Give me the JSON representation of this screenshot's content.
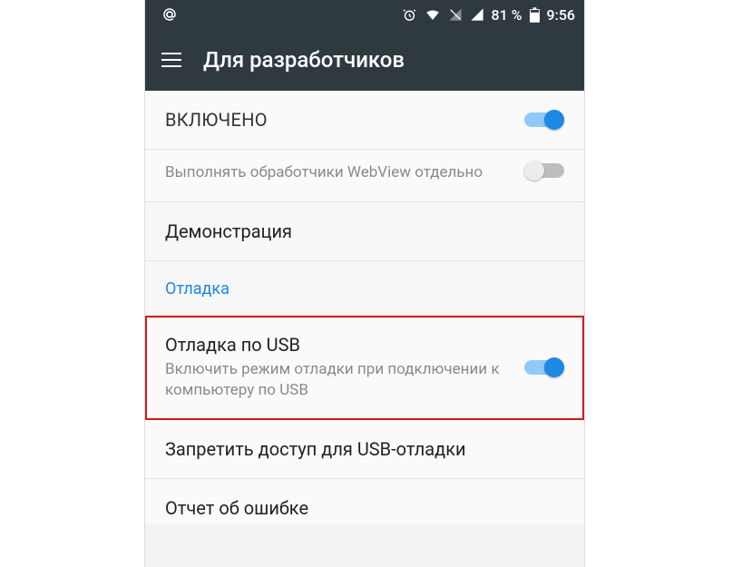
{
  "statusbar": {
    "battery_percent": "81 %",
    "time": "9:56"
  },
  "appbar": {
    "title": "Для разработчиков"
  },
  "rows": {
    "enabled_label": "ВКЛЮЧЕНО",
    "webview_secondary": "Выполнять обработчики WebView отдельно",
    "demo_label": "Демонстрация",
    "section_debug": "Отладка",
    "usb_debug_title": "Отладка по USB",
    "usb_debug_desc": "Включить режим отладки при подключении к компьютеру по USB",
    "revoke_label": "Запретить доступ для USB-отладки",
    "bugreport_label": "Отчет об ошибке"
  },
  "toggles": {
    "enabled": true,
    "webview": false,
    "usb_debug": true
  }
}
